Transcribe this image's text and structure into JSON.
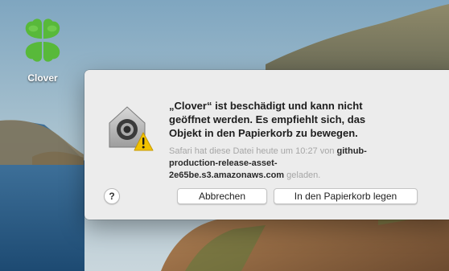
{
  "desktop": {
    "app_icon": {
      "name": "clover-leaf-icon",
      "label": "Clover"
    }
  },
  "dialog": {
    "icon": "gatekeeper-warning-icon",
    "title": "„Clover“ ist beschädigt und kann nicht geöffnet werden. Es empfiehlt sich, das Objekt in den Papierkorb zu bewegen.",
    "info_prefix": "Safari hat diese Datei heute um 10:27 von",
    "info_host": "github-production-release-asset-2e65be.s3.amazonaws.com",
    "info_suffix": "geladen.",
    "help_label": "?",
    "cancel_label": "Abbrechen",
    "trash_label": "In den Papierkorb legen"
  },
  "colors": {
    "dialog_bg": "#ececec",
    "clover_green": "#58b93a",
    "warning_yellow": "#f2c200"
  }
}
